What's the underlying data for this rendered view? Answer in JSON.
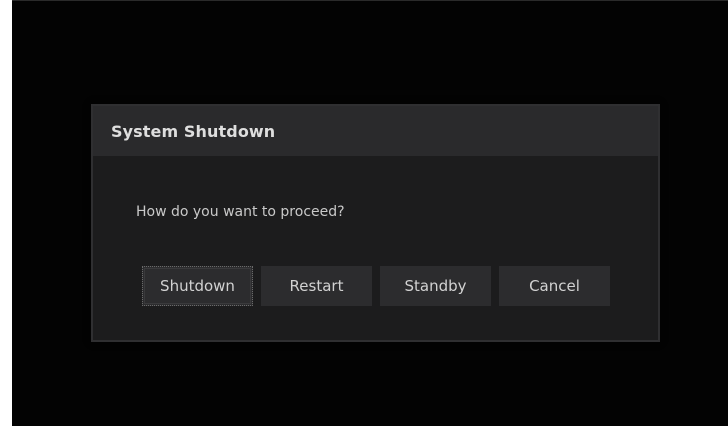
{
  "dialog": {
    "title": "System Shutdown",
    "message": "How do you want to proceed?",
    "buttons": {
      "shutdown": "Shutdown",
      "restart": "Restart",
      "standby": "Standby",
      "cancel": "Cancel"
    },
    "focused_button": "Shutdown"
  },
  "colors": {
    "screen_background": "#030303",
    "dialog_background": "#1c1c1d",
    "header_background": "#2a2a2c",
    "button_background": "#2c2c2e",
    "text": "#d2d2d2"
  }
}
